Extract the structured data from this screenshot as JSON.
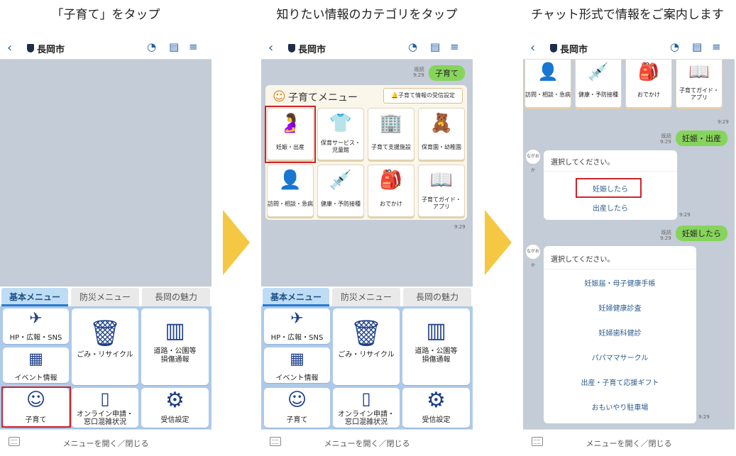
{
  "captions": [
    "「子育て」をタップ",
    "知りたい情報のカテゴリをタップ",
    "チャット形式で情報をご案内します"
  ],
  "header": {
    "back": "‹",
    "city": "長岡市"
  },
  "tabs": [
    "基本メニュー",
    "防災メニュー",
    "長岡の魅力"
  ],
  "menu": {
    "hp": "HP・広報・SNS",
    "garbage": "ごみ・リサイクル",
    "road": "道路・公園等",
    "road2": "損傷通報",
    "event": "イベント情報",
    "online": "オンライン申請・",
    "online2": "窓口混雑状況",
    "child": "子育て",
    "settings": "受信設定"
  },
  "footer": "メニューを開く／閉じる",
  "chat2": {
    "read": "既読",
    "time": "9:29",
    "msg": "子育て",
    "menu_title": "子育てメニュー",
    "receive_btn": "子育て情報の受信設定",
    "stamp": "9:29"
  },
  "categories": [
    {
      "l1": "妊娠・出産",
      "l2": ""
    },
    {
      "l1": "保育サービス・",
      "l2": "児童館"
    },
    {
      "l1": "子育て支援施設",
      "l2": ""
    },
    {
      "l1": "保育園・幼稚園",
      "l2": ""
    },
    {
      "l1": "訪問・相談・急病",
      "l2": ""
    },
    {
      "l1": "健康・予防接種",
      "l2": ""
    },
    {
      "l1": "おでかけ",
      "l2": ""
    },
    {
      "l1": "子育てガイド・",
      "l2": "アプリ"
    }
  ],
  "chat3": {
    "read": "既読",
    "time": "9:29",
    "msg1": "妊娠・出産",
    "select": "選択してください。",
    "opt1": "妊娠したら",
    "opt2": "出産したら",
    "msg2": "妊娠したら",
    "bot": "ながおか",
    "list": [
      "妊娠届・母子健康手帳",
      "妊婦健康診査",
      "妊婦歯科健診",
      "パパママサークル",
      "出産・子育て応援ギフト",
      "おもいやり駐車場"
    ]
  },
  "colors": {
    "accent": "#1f5fa5",
    "bubble": "#87d45c",
    "highlight": "#d0232a",
    "arrow": "#f4c842"
  }
}
